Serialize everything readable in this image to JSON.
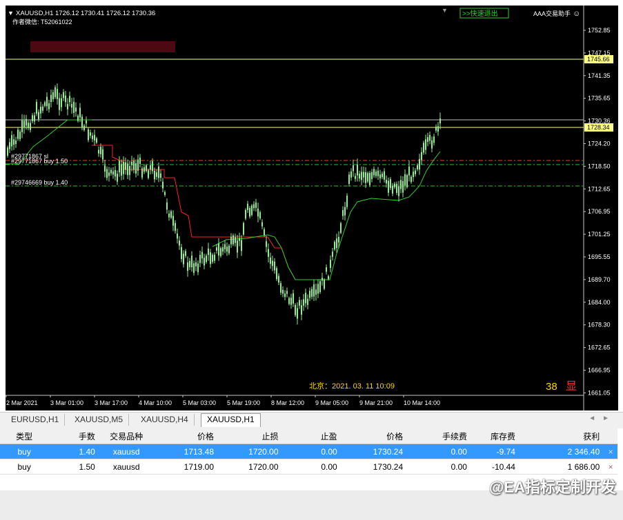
{
  "chart": {
    "symbol_header": "XAUUSD,H1  1726.12 1730.41 1726.12 1730.36",
    "author_line": "作者微信:  T52061022",
    "quick_exit_label": ">>快速退出",
    "assistant_label": "AAA交易助手",
    "beijing_time": "北京：2021. 03. 11  10:09",
    "counter": "38",
    "display_char": "显",
    "line_labels": [
      "#29771867 sl",
      "#29771867 buy 1.50",
      "#29746669 buy 1.40"
    ],
    "price_ticks": [
      "1752.85",
      "1747.15",
      "1741.35",
      "1735.65",
      "1730.36",
      "1724.20",
      "1718.50",
      "1712.65",
      "1706.95",
      "1701.25",
      "1695.55",
      "1689.70",
      "1684.00",
      "1678.30",
      "1672.65",
      "1666.95",
      "1661.05"
    ],
    "price_tags": [
      "1745.66",
      "1728.34"
    ],
    "time_ticks": [
      "2 Mar 2021",
      "3 Mar 01:00",
      "3 Mar 17:00",
      "4 Mar 10:00",
      "5 Mar 03:00",
      "5 Mar 19:00",
      "8 Mar 12:00",
      "9 Mar 05:00",
      "9 Mar 21:00",
      "10 Mar 14:00"
    ],
    "colors": {
      "bull": "#90ee90",
      "red_line": "#ff2020",
      "green_line": "#30d030",
      "hline": "#ffff80",
      "grey_line": "#c0c0c0",
      "text_yellow": "#ffd700"
    }
  },
  "tabs": [
    "EURUSD,H1",
    "XAUUSD,M5",
    "XAUUSD,H4",
    "XAUUSD,H1"
  ],
  "active_tab": "XAUUSD,H1",
  "positions": {
    "headers": [
      "类型",
      "手数",
      "交易品种",
      "价格",
      "止损",
      "止盈",
      "价格",
      "手续费",
      "库存费",
      "获利"
    ],
    "rows": [
      {
        "type": "buy",
        "lots": "1.40",
        "symbol": "xauusd",
        "open": "1713.48",
        "sl": "1720.00",
        "tp": "0.00",
        "price": "1730.24",
        "commission": "0.00",
        "swap": "-9.74",
        "profit": "2 346.40"
      },
      {
        "type": "buy",
        "lots": "1.50",
        "symbol": "xauusd",
        "open": "1719.00",
        "sl": "1720.00",
        "tp": "0.00",
        "price": "1730.24",
        "commission": "0.00",
        "swap": "-10.44",
        "profit": "1 686.00"
      }
    ],
    "close_icon": "×"
  },
  "watermark": "@EA指标定制开发"
}
